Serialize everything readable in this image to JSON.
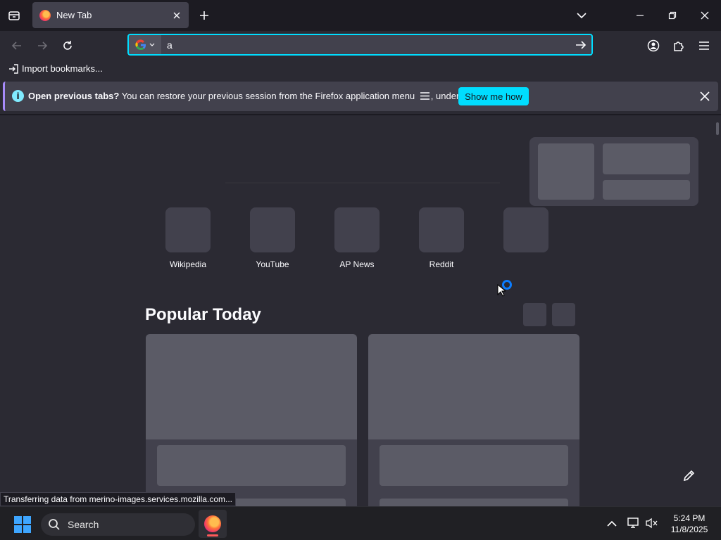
{
  "browser": {
    "tab": {
      "title": "New Tab"
    },
    "urlbar": {
      "value": "a",
      "engine": "Google"
    },
    "bookmarks": {
      "import_label": "Import bookmarks..."
    }
  },
  "notification": {
    "bold_text": "Open previous tabs?",
    "text": "You can restore your previous session from the Firefox application menu",
    "text_after": ", under History.",
    "button_label": "Show me how"
  },
  "newtab": {
    "shortcuts": [
      {
        "label": "Wikipedia"
      },
      {
        "label": "YouTube"
      },
      {
        "label": "AP News"
      },
      {
        "label": "Reddit"
      },
      {
        "label": ""
      }
    ],
    "popular_title": "Popular Today"
  },
  "status_text": "Transferring data from merino-images.services.mozilla.com...",
  "taskbar": {
    "search_label": "Search",
    "time": "5:24 PM",
    "date": "11/8/2025"
  },
  "colors": {
    "accent": "#00ddff",
    "toolbar": "#2b2a33",
    "tabstrip": "#1c1b22",
    "placeholder": "#42414d"
  }
}
